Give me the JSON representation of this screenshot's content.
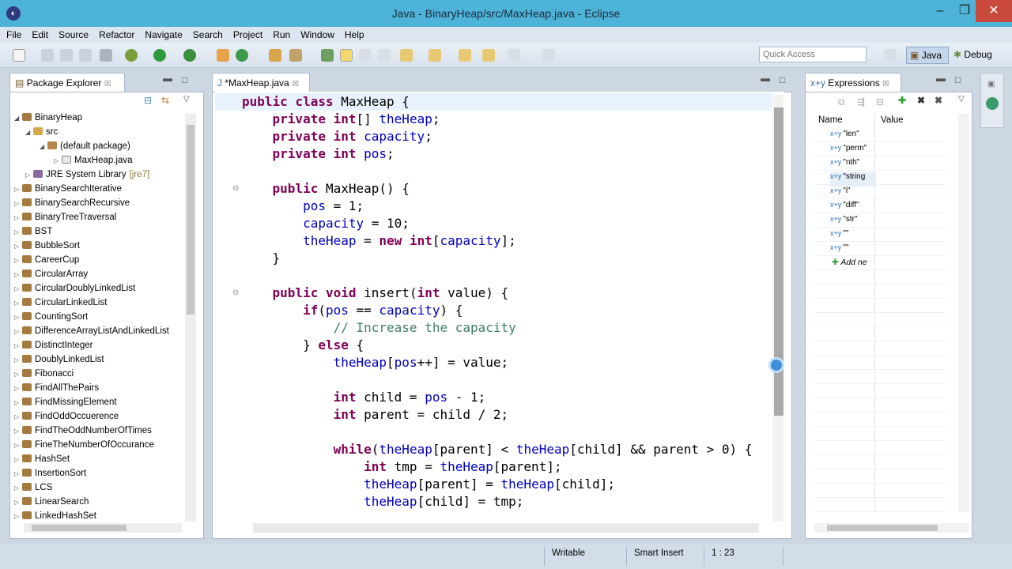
{
  "window": {
    "title": "Java - BinaryHeap/src/MaxHeap.java - Eclipse"
  },
  "menu": [
    "File",
    "Edit",
    "Source",
    "Refactor",
    "Navigate",
    "Search",
    "Project",
    "Run",
    "Window",
    "Help"
  ],
  "quick_access": {
    "placeholder": "Quick Access"
  },
  "perspectives": {
    "java": "Java",
    "debug": "Debug"
  },
  "package_explorer": {
    "tab": "Package Explorer",
    "tree": [
      {
        "label": "BinaryHeap",
        "depth": 0,
        "expanded": true,
        "kind": "project"
      },
      {
        "label": "src",
        "depth": 1,
        "expanded": true,
        "kind": "folder"
      },
      {
        "label": "(default package)",
        "depth": 2,
        "expanded": true,
        "kind": "package"
      },
      {
        "label": "MaxHeap.java",
        "depth": 3,
        "expanded": false,
        "kind": "file"
      },
      {
        "label": "JRE System Library",
        "depth": 1,
        "expanded": false,
        "kind": "library",
        "suffix": "[jre7]"
      },
      {
        "label": "BinarySearchIterative",
        "depth": 0,
        "kind": "project"
      },
      {
        "label": "BinarySearchRecursive",
        "depth": 0,
        "kind": "project"
      },
      {
        "label": "BinaryTreeTraversal",
        "depth": 0,
        "kind": "project"
      },
      {
        "label": "BST",
        "depth": 0,
        "kind": "project"
      },
      {
        "label": "BubbleSort",
        "depth": 0,
        "kind": "project"
      },
      {
        "label": "CareerCup",
        "depth": 0,
        "kind": "project"
      },
      {
        "label": "CircularArray",
        "depth": 0,
        "kind": "project"
      },
      {
        "label": "CircularDoublyLinkedList",
        "depth": 0,
        "kind": "project"
      },
      {
        "label": "CircularLinkedList",
        "depth": 0,
        "kind": "project"
      },
      {
        "label": "CountingSort",
        "depth": 0,
        "kind": "project"
      },
      {
        "label": "DifferenceArrayListAndLinkedList",
        "depth": 0,
        "kind": "project"
      },
      {
        "label": "DistinctInteger",
        "depth": 0,
        "kind": "project"
      },
      {
        "label": "DoublyLinkedList",
        "depth": 0,
        "kind": "project"
      },
      {
        "label": "Fibonacci",
        "depth": 0,
        "kind": "project"
      },
      {
        "label": "FindAllThePairs",
        "depth": 0,
        "kind": "project"
      },
      {
        "label": "FindMissingElement",
        "depth": 0,
        "kind": "project"
      },
      {
        "label": "FindOddOccuerence",
        "depth": 0,
        "kind": "project"
      },
      {
        "label": "FindTheOddNumberOfTimes",
        "depth": 0,
        "kind": "project"
      },
      {
        "label": "FineTheNumberOfOccurance",
        "depth": 0,
        "kind": "project"
      },
      {
        "label": "HashSet",
        "depth": 0,
        "kind": "project"
      },
      {
        "label": "InsertionSort",
        "depth": 0,
        "kind": "project"
      },
      {
        "label": "LCS",
        "depth": 0,
        "kind": "project"
      },
      {
        "label": "LinearSearch",
        "depth": 0,
        "kind": "project"
      },
      {
        "label": "LinkedHashSet",
        "depth": 0,
        "kind": "project"
      }
    ]
  },
  "editor": {
    "tab": "*MaxHeap.java",
    "lines": [
      [
        [
          "kw",
          "public "
        ],
        [
          "kw",
          "class "
        ],
        [
          "t",
          "MaxHeap {"
        ]
      ],
      [
        [
          "t",
          "    "
        ],
        [
          "kw",
          "private "
        ],
        [
          "kw",
          "int"
        ],
        [
          "t",
          "[] "
        ],
        [
          "fld",
          "theHeap"
        ],
        [
          "t",
          ";"
        ]
      ],
      [
        [
          "t",
          "    "
        ],
        [
          "kw",
          "private "
        ],
        [
          "kw",
          "int "
        ],
        [
          "fld",
          "capacity"
        ],
        [
          "t",
          ";"
        ]
      ],
      [
        [
          "t",
          "    "
        ],
        [
          "kw",
          "private "
        ],
        [
          "kw",
          "int "
        ],
        [
          "fld",
          "pos"
        ],
        [
          "t",
          ";"
        ]
      ],
      [],
      [
        [
          "t",
          "    "
        ],
        [
          "kw",
          "public "
        ],
        [
          "t",
          "MaxHeap() {"
        ]
      ],
      [
        [
          "t",
          "        "
        ],
        [
          "fld",
          "pos"
        ],
        [
          "t",
          " = 1;"
        ]
      ],
      [
        [
          "t",
          "        "
        ],
        [
          "fld",
          "capacity"
        ],
        [
          "t",
          " = 10;"
        ]
      ],
      [
        [
          "t",
          "        "
        ],
        [
          "fld",
          "theHeap"
        ],
        [
          "t",
          " = "
        ],
        [
          "kw",
          "new "
        ],
        [
          "kw",
          "int"
        ],
        [
          "t",
          "["
        ],
        [
          "fld",
          "capacity"
        ],
        [
          "t",
          "];"
        ]
      ],
      [
        [
          "t",
          "    }"
        ]
      ],
      [],
      [
        [
          "t",
          "    "
        ],
        [
          "kw",
          "public "
        ],
        [
          "kw",
          "void "
        ],
        [
          "t",
          "insert("
        ],
        [
          "kw",
          "int "
        ],
        [
          "t",
          "value) {"
        ]
      ],
      [
        [
          "t",
          "        "
        ],
        [
          "kw",
          "if"
        ],
        [
          "t",
          "("
        ],
        [
          "fld",
          "pos"
        ],
        [
          "t",
          " == "
        ],
        [
          "fld",
          "capacity"
        ],
        [
          "t",
          ") {"
        ]
      ],
      [
        [
          "t",
          "            "
        ],
        [
          "cm",
          "// Increase the capacity"
        ]
      ],
      [
        [
          "t",
          "        } "
        ],
        [
          "kw",
          "else "
        ],
        [
          "t",
          "{"
        ]
      ],
      [
        [
          "t",
          "            "
        ],
        [
          "fld",
          "theHeap"
        ],
        [
          "t",
          "["
        ],
        [
          "fld",
          "pos"
        ],
        [
          "t",
          "++] = value;"
        ]
      ],
      [],
      [
        [
          "t",
          "            "
        ],
        [
          "kw",
          "int "
        ],
        [
          "t",
          "child = "
        ],
        [
          "fld",
          "pos"
        ],
        [
          "t",
          " - 1;"
        ]
      ],
      [
        [
          "t",
          "            "
        ],
        [
          "kw",
          "int "
        ],
        [
          "t",
          "parent = child / 2;"
        ]
      ],
      [],
      [
        [
          "t",
          "            "
        ],
        [
          "kw",
          "while"
        ],
        [
          "t",
          "("
        ],
        [
          "fld",
          "theHeap"
        ],
        [
          "t",
          "[parent] < "
        ],
        [
          "fld",
          "theHeap"
        ],
        [
          "t",
          "[child] && parent > 0) {"
        ]
      ],
      [
        [
          "t",
          "                "
        ],
        [
          "kw",
          "int "
        ],
        [
          "t",
          "tmp = "
        ],
        [
          "fld",
          "theHeap"
        ],
        [
          "t",
          "[parent];"
        ]
      ],
      [
        [
          "t",
          "                "
        ],
        [
          "fld",
          "theHeap"
        ],
        [
          "t",
          "[parent] = "
        ],
        [
          "fld",
          "theHeap"
        ],
        [
          "t",
          "[child];"
        ]
      ],
      [
        [
          "t",
          "                "
        ],
        [
          "fld",
          "theHeap"
        ],
        [
          "t",
          "[child] = tmp;"
        ]
      ]
    ]
  },
  "expressions": {
    "tab": "Expressions",
    "col_name": "Name",
    "col_value": "Value",
    "rows": [
      "\"len\"",
      "\"perm\"",
      "\"nth\"",
      "\"string",
      "\"i\"",
      "\"diff\"",
      "\"str\"",
      "\"\"",
      "\"\""
    ],
    "add_label": "Add ne"
  },
  "status": {
    "writable": "Writable",
    "insert_mode": "Smart Insert",
    "position": "1 : 23"
  }
}
